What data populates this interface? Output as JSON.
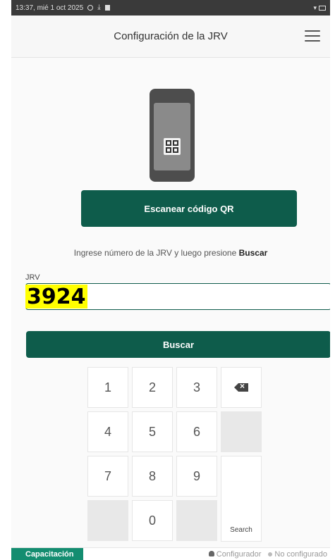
{
  "status_bar": {
    "time_date": "13:37, mié 1 oct 2025"
  },
  "header": {
    "title": "Configuración de la JRV"
  },
  "scan": {
    "button_label": "Escanear código QR"
  },
  "hint": {
    "text": "Ingrese número de la JRV y luego presione ",
    "action": "Buscar"
  },
  "jrv": {
    "label": "JRV",
    "value": "3924"
  },
  "search": {
    "button_label": "Buscar"
  },
  "keypad": {
    "keys": [
      "1",
      "2",
      "3",
      "4",
      "5",
      "6",
      "7",
      "8",
      "9",
      "0"
    ],
    "search_key": "Search"
  },
  "footer": {
    "mode_badge": "Capacitación",
    "role": "Configurador",
    "status": "No configurado"
  },
  "colors": {
    "primary": "#0e5c4b",
    "badge": "#138d70",
    "highlight": "#ffff00"
  }
}
